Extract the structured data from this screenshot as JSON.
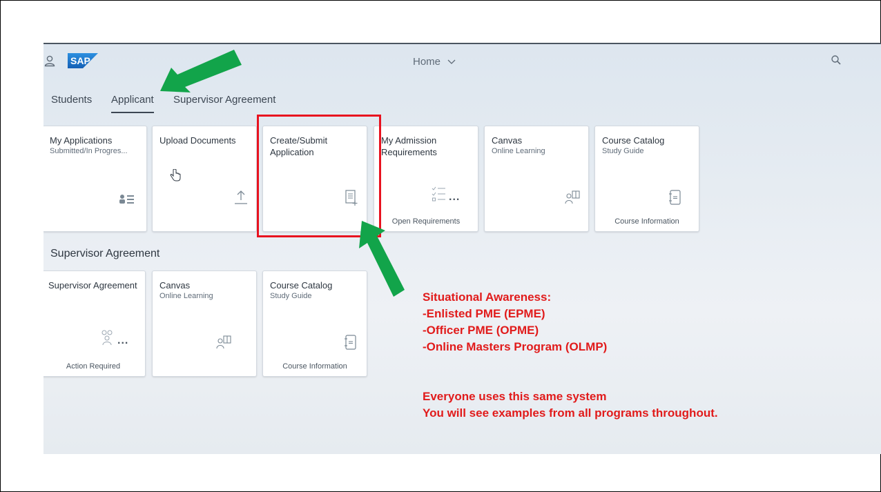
{
  "shellbar": {
    "logo_text": "SAP",
    "title": "Home"
  },
  "tabs": [
    {
      "label": "Students",
      "active": false
    },
    {
      "label": "Applicant",
      "active": true
    },
    {
      "label": "Supervisor Agreement",
      "active": false
    }
  ],
  "applicant_tiles": [
    {
      "title": "My Applications",
      "subtitle": "Submitted/In Progres...",
      "icon": "applications-icon"
    },
    {
      "title": "Upload Documents",
      "subtitle": "",
      "icon": "upload-icon"
    },
    {
      "title": "Create/Submit Application",
      "subtitle": "",
      "icon": "create-document-icon"
    },
    {
      "title": "My Admission Requirements",
      "subtitle": "",
      "icon": "checklist-icon",
      "indicator": "...",
      "footer": "Open Requirements"
    },
    {
      "title": "Canvas",
      "subtitle": "Online Learning",
      "icon": "learning-icon"
    },
    {
      "title": "Course Catalog",
      "subtitle": "Study Guide",
      "icon": "catalog-icon",
      "footer": "Course Information"
    }
  ],
  "section_title": "Supervisor Agreement",
  "supervisor_tiles": [
    {
      "title": "Supervisor Agreement",
      "subtitle": "",
      "icon": "group-icon",
      "indicator": "...",
      "footer": "Action Required"
    },
    {
      "title": "Canvas",
      "subtitle": "Online Learning",
      "icon": "learning-icon"
    },
    {
      "title": "Course Catalog",
      "subtitle": "Study Guide",
      "icon": "catalog-icon",
      "footer": "Course Information"
    }
  ],
  "annotation": {
    "heading": "Situational Awareness:",
    "items": [
      "-Enlisted PME (EPME)",
      "-Officer PME (OPME)",
      "-Online Masters Program (OLMP)"
    ],
    "note_line_1": "Everyone uses this same system",
    "note_line_2": "You will see examples from all programs throughout."
  },
  "colors": {
    "annotation_red": "#e11b1b",
    "arrow_green": "#12a44a",
    "sap_blue": "#1a73c9"
  }
}
